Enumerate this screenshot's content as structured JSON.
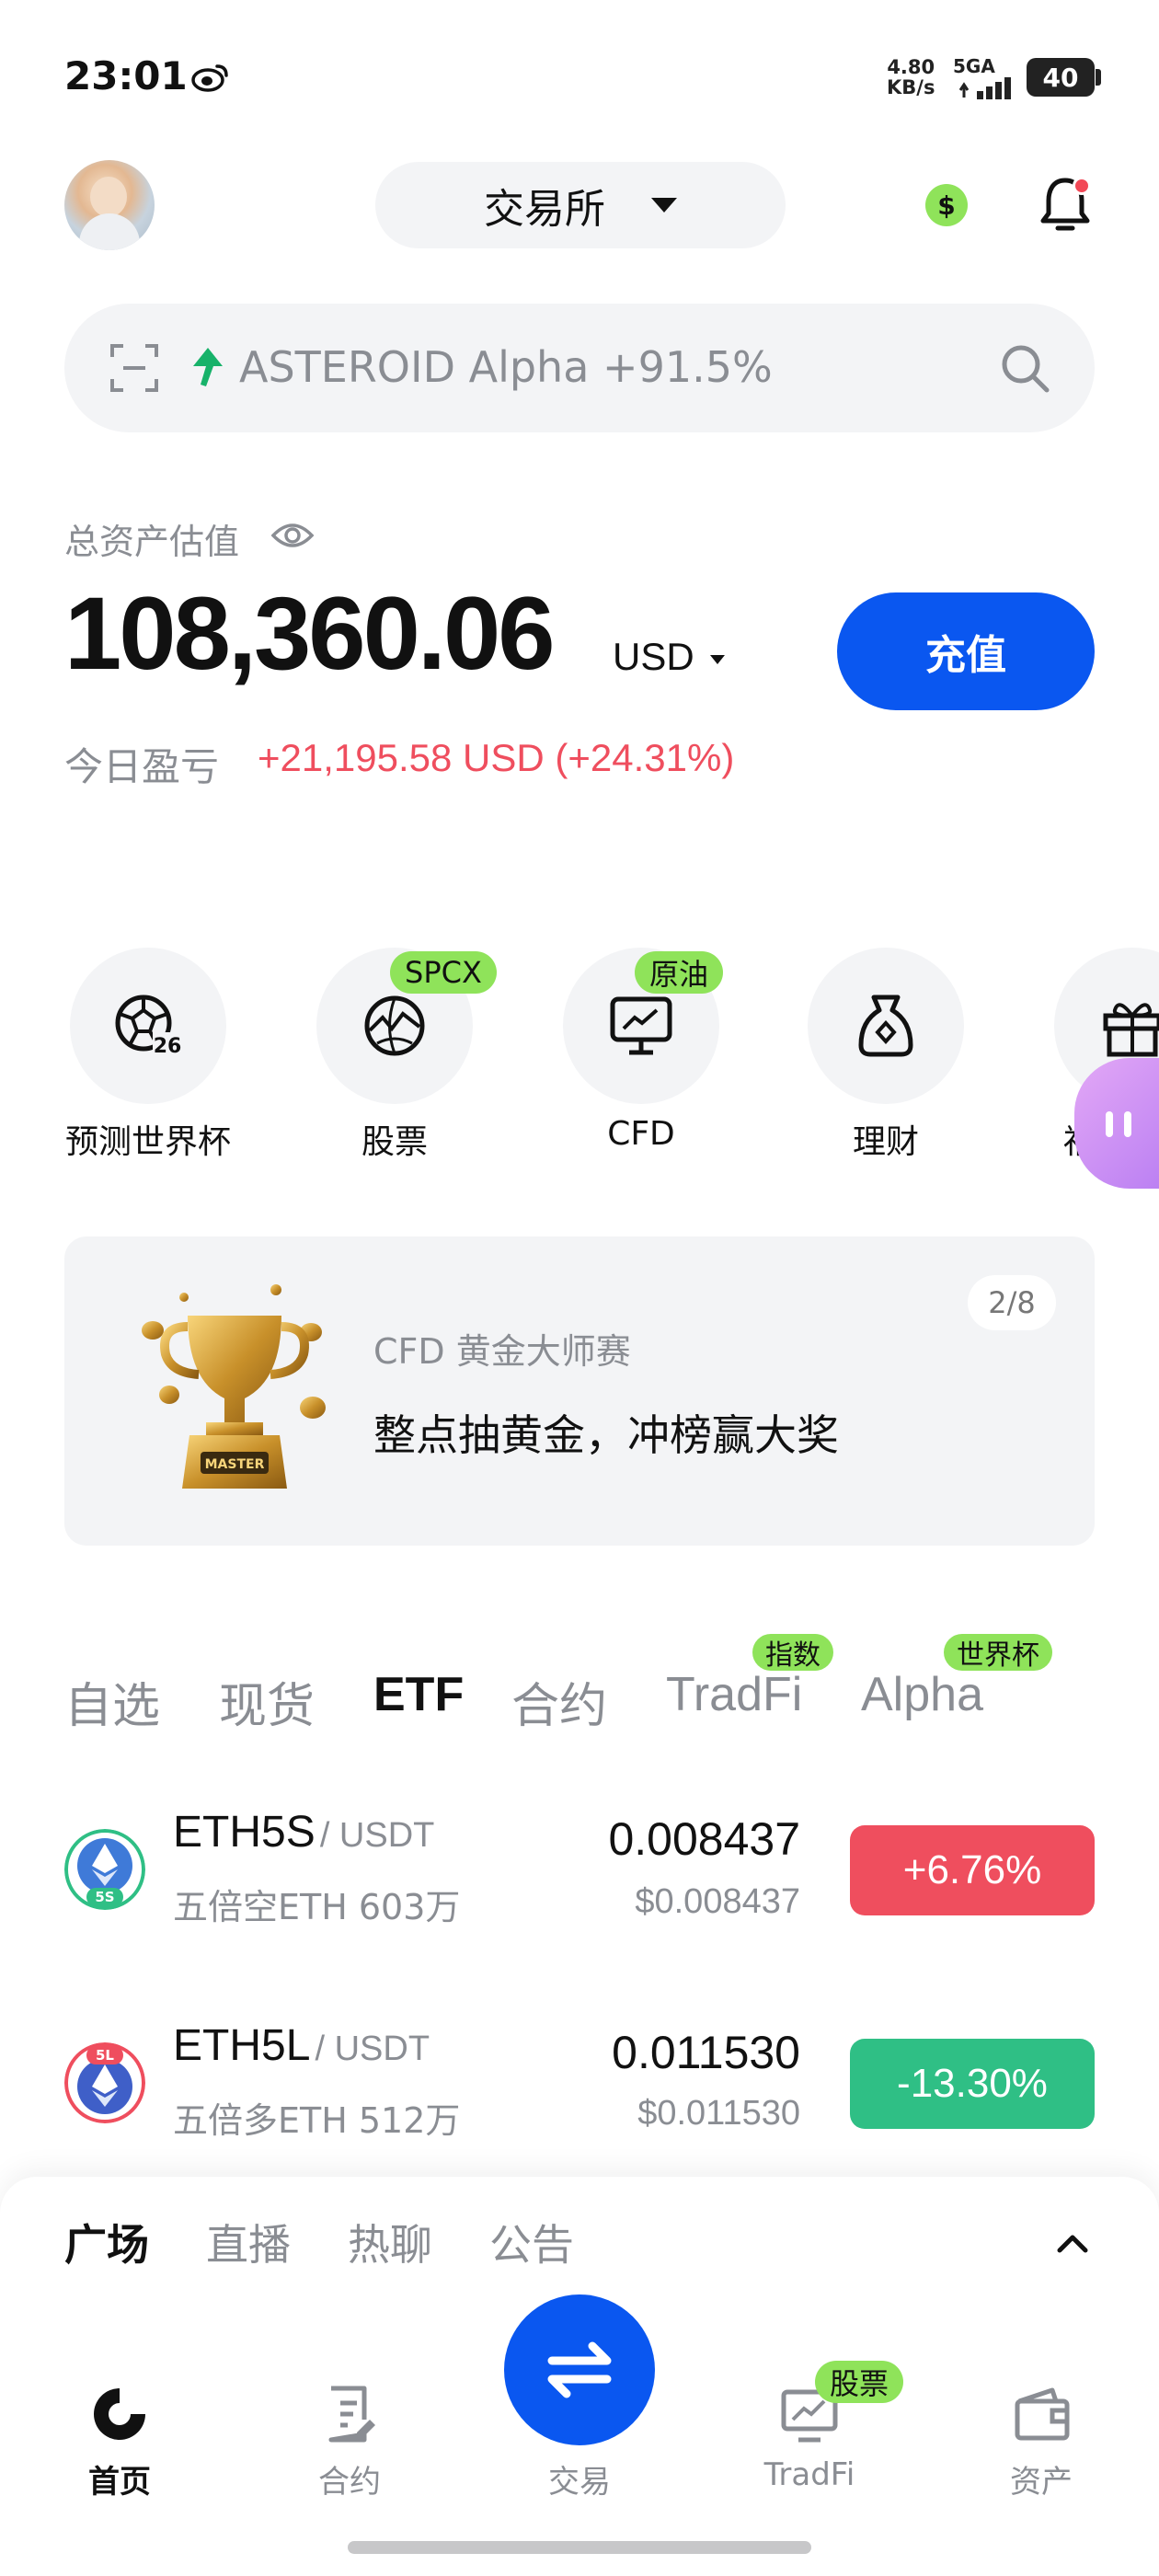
{
  "status_bar": {
    "time": "23:01",
    "speed_value": "4.80",
    "speed_unit": "KB/s",
    "network": "5GA",
    "battery": "40"
  },
  "header": {
    "exchange_label": "交易所",
    "dollar_symbol": "$"
  },
  "search": {
    "trending_text": "ASTEROID Alpha +91.5%"
  },
  "assets": {
    "label": "总资产估值",
    "balance": "108,360.06",
    "currency": "USD",
    "deposit_label": "充值",
    "pnl_label": "今日盈亏",
    "pnl_value": "+21,195.58 USD (+24.31%)"
  },
  "shortcuts": [
    {
      "label": "预测世界杯",
      "badge": ""
    },
    {
      "label": "股票",
      "badge": "SPCX"
    },
    {
      "label": "CFD",
      "badge": "原油"
    },
    {
      "label": "理财",
      "badge": ""
    },
    {
      "label": "福利中",
      "badge": ""
    }
  ],
  "banner": {
    "counter": "2/8",
    "subtitle": "CFD 黄金大师赛",
    "title": "整点抽黄金，冲榜赢大奖",
    "trophy_text": "MASTER"
  },
  "market_tabs": [
    {
      "label": "自选",
      "badge": ""
    },
    {
      "label": "现货",
      "badge": ""
    },
    {
      "label": "ETF",
      "badge": ""
    },
    {
      "label": "合约",
      "badge": ""
    },
    {
      "label": "TradFi",
      "badge": "指数"
    },
    {
      "label": "Alpha",
      "badge": "世界杯"
    }
  ],
  "active_market_tab": "ETF",
  "list": [
    {
      "symbol": "ETH5S",
      "quote": "/ USDT",
      "desc": "五倍空ETH 603万",
      "price": "0.008437",
      "price_usd": "$0.008437",
      "change": "+6.76%",
      "change_color": "#ef4e5e",
      "logo_badge": "5S",
      "logo_badge_color": "#2fbf85"
    },
    {
      "symbol": "ETH5L",
      "quote": "/ USDT",
      "desc": "五倍多ETH 512万",
      "price": "0.011530",
      "price_usd": "$0.011530",
      "change": "-13.30%",
      "change_color": "#2fbf85",
      "logo_badge": "5L",
      "logo_badge_color": "#ef4e5e"
    }
  ],
  "sheet_tabs": [
    "广场",
    "直播",
    "热聊",
    "公告"
  ],
  "nav": {
    "home": "首页",
    "futures": "合约",
    "trade": "交易",
    "tradfi": "TradFi",
    "tradfi_badge": "股票",
    "assets": "资产"
  },
  "colors": {
    "accent_blue": "#0a57f0",
    "green_badge": "#8fe35a",
    "up_red": "#ef4e5e",
    "down_green": "#2fbf85"
  }
}
